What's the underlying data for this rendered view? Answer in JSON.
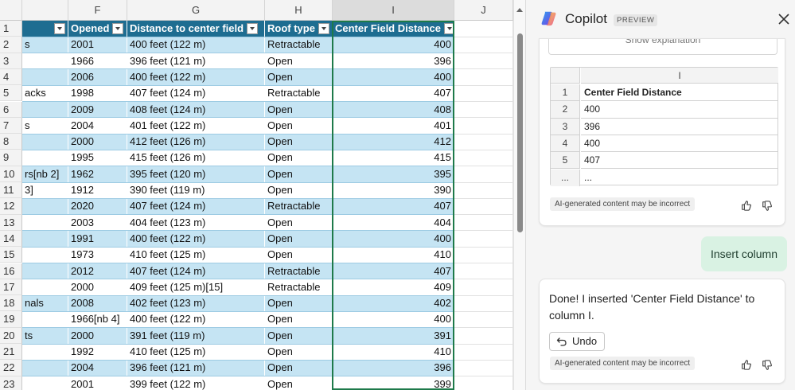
{
  "spreadsheet": {
    "column_headers": [
      "F",
      "G",
      "H",
      "I",
      "J"
    ],
    "table_headers": {
      "e": "",
      "opened": "Opened",
      "distance": "Distance to center field",
      "roof": "Roof type",
      "center": "Center Field Distance"
    },
    "row_numbers": [
      "1",
      "2",
      "3",
      "4",
      "5",
      "6",
      "7",
      "8",
      "9",
      "10",
      "11",
      "12",
      "13",
      "14",
      "15",
      "16",
      "17",
      "18",
      "19",
      "20",
      "21",
      "22",
      "23"
    ],
    "rows": [
      {
        "e": "s",
        "opened": "2001",
        "distance": "400 feet (122 m)",
        "roof": "Retractable",
        "center": "400"
      },
      {
        "e": "",
        "opened": "1966",
        "distance": "396 feet (121 m)",
        "roof": "Open",
        "center": "396"
      },
      {
        "e": "",
        "opened": "2006",
        "distance": "400 feet (122 m)",
        "roof": "Open",
        "center": "400"
      },
      {
        "e": "acks",
        "opened": "1998",
        "distance": "407 feet (124 m)",
        "roof": "Retractable",
        "center": "407"
      },
      {
        "e": "",
        "opened": "2009",
        "distance": "408 feet (124 m)",
        "roof": "Open",
        "center": "408"
      },
      {
        "e": "s",
        "opened": "2004",
        "distance": "401 feet (122 m)",
        "roof": "Open",
        "center": "401"
      },
      {
        "e": "",
        "opened": "2000",
        "distance": "412 feet (126 m)",
        "roof": "Open",
        "center": "412"
      },
      {
        "e": "",
        "opened": "1995",
        "distance": "415 feet (126 m)",
        "roof": "Open",
        "center": "415"
      },
      {
        "e": "rs[nb 2]",
        "opened": "1962",
        "distance": "395 feet (120 m)",
        "roof": "Open",
        "center": "395"
      },
      {
        "e": " 3]",
        "opened": "1912",
        "distance": "390 feet (119 m)",
        "roof": "Open",
        "center": "390"
      },
      {
        "e": "",
        "opened": "2020",
        "distance": "407 feet (124 m)",
        "roof": "Retractable",
        "center": "407"
      },
      {
        "e": "",
        "opened": "2003",
        "distance": "404 feet (123 m)",
        "roof": "Open",
        "center": "404"
      },
      {
        "e": "",
        "opened": "1991",
        "distance": "400 feet (122 m)",
        "roof": "Open",
        "center": "400"
      },
      {
        "e": "",
        "opened": "1973",
        "distance": "410 feet (125 m)",
        "roof": "Open",
        "center": "410"
      },
      {
        "e": "",
        "opened": "2012",
        "distance": "407 feet (124 m)",
        "roof": "Retractable",
        "center": "407"
      },
      {
        "e": "",
        "opened": "2000",
        "distance": "409 feet (125 m)[15]",
        "roof": "Retractable",
        "center": "409"
      },
      {
        "e": "nals",
        "opened": "2008",
        "distance": "402 feet (123 m)",
        "roof": "Open",
        "center": "402"
      },
      {
        "e": "",
        "opened": "1966[nb 4]",
        "distance": "400 feet (122 m)",
        "roof": "Open",
        "center": "400"
      },
      {
        "e": "ts",
        "opened": "2000",
        "distance": "391 feet (119 m)",
        "roof": "Open",
        "center": "391"
      },
      {
        "e": "",
        "opened": "1992",
        "distance": "410 feet (125 m)",
        "roof": "Open",
        "center": "410"
      },
      {
        "e": "",
        "opened": "2004",
        "distance": "396 feet (121 m)",
        "roof": "Open",
        "center": "396"
      },
      {
        "e": "",
        "opened": "2001",
        "distance": "399 feet (122 m)",
        "roof": "Open",
        "center": "399"
      }
    ]
  },
  "copilot": {
    "title": "Copilot",
    "badge": "PREVIEW",
    "show_explanation": "Show explanation",
    "preview_table": {
      "column_header": "I",
      "rows": [
        {
          "num": "1",
          "value": "Center Field Distance"
        },
        {
          "num": "2",
          "value": "400"
        },
        {
          "num": "3",
          "value": "396"
        },
        {
          "num": "4",
          "value": "400"
        },
        {
          "num": "5",
          "value": "407"
        },
        {
          "num": "...",
          "value": "..."
        }
      ]
    },
    "disclaimer": "AI-generated content may be incorrect",
    "user_message": "Insert column",
    "reply": "Done! I inserted 'Center Field Distance' to column I.",
    "undo_label": "Undo"
  },
  "colors": {
    "table_header": "#1e6d91",
    "band": "#c5e4f3",
    "selection": "#1e7a4a",
    "user_bubble": "#d9f2e3"
  }
}
